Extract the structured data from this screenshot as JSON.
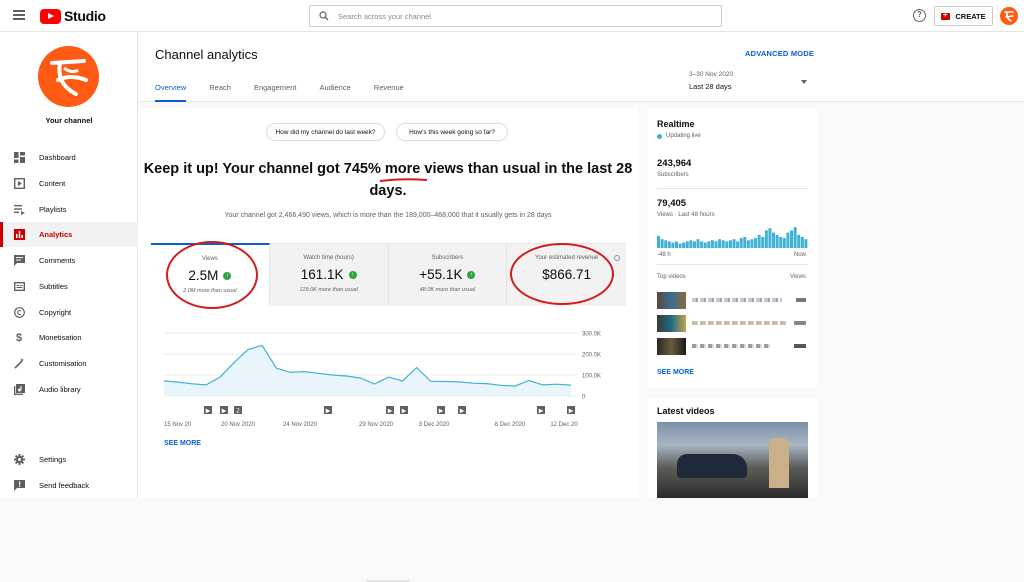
{
  "topbar": {
    "logo_text": "Studio",
    "search_placeholder": "Search across your channel",
    "help_glyph": "?",
    "create_label": "CREATE"
  },
  "sidebar": {
    "channel_label": "Your channel",
    "items": [
      {
        "label": "Dashboard",
        "icon": "dashboard-icon"
      },
      {
        "label": "Content",
        "icon": "content-icon"
      },
      {
        "label": "Playlists",
        "icon": "playlists-icon"
      },
      {
        "label": "Analytics",
        "icon": "analytics-icon"
      },
      {
        "label": "Comments",
        "icon": "comments-icon"
      },
      {
        "label": "Subtitles",
        "icon": "subtitles-icon"
      },
      {
        "label": "Copyright",
        "icon": "copyright-icon"
      },
      {
        "label": "Monetisation",
        "icon": "dollar-icon"
      },
      {
        "label": "Customisation",
        "icon": "magic-wand-icon"
      },
      {
        "label": "Audio library",
        "icon": "audio-library-icon"
      },
      {
        "label": "Settings",
        "icon": "gear-icon"
      },
      {
        "label": "Send feedback",
        "icon": "feedback-icon"
      }
    ]
  },
  "header": {
    "title": "Channel analytics",
    "advanced_mode": "ADVANCED MODE",
    "tabs": [
      "Overview",
      "Reach",
      "Engagement",
      "Audience",
      "Revenue"
    ],
    "date_range": "3–30 Nov 2020",
    "date_label": "Last 28 days"
  },
  "overview": {
    "chip_1": "How did my channel do last week?",
    "chip_2": "How's this week going so far?",
    "headline_pre": "Keep it up! Your channel got ",
    "headline_highlight": "745%",
    "headline_post": " more views than usual in the last 28 days.",
    "subline": "Your channel got 2,466,490 views, which is more than the 189,000–468,000 that it usually gets in 28 days",
    "metrics": [
      {
        "label": "Views",
        "value": "2.5M",
        "note": "2.0M more than usual"
      },
      {
        "label": "Watch time (hours)",
        "value": "161.1K",
        "note": "129.0K more than usual"
      },
      {
        "label": "Subscribers",
        "value": "+55.1K",
        "note": "48.0K more than usual"
      },
      {
        "label": "Your estimated revenue",
        "value": "$866.71",
        "note": ""
      }
    ],
    "see_more": "SEE MORE"
  },
  "chart_data": {
    "type": "area",
    "series": [
      {
        "values": [
          72000,
          66000,
          58000,
          53000,
          90000,
          160000,
          222000,
          241000,
          133000,
          113000,
          116000,
          108000,
          100000,
          95000,
          85000,
          57000,
          90000,
          72000,
          135000,
          70000,
          69000,
          67000,
          61000,
          59000,
          51000,
          47000,
          74000,
          53000,
          56000,
          52000
        ]
      }
    ],
    "x_tick_labels": [
      "15 Nov 20",
      "20 Nov 2020",
      "24 Nov 2020",
      "29 Nov 2020",
      "3 Dec 2020",
      "8 Dec 2020",
      "12 Dec 20"
    ],
    "y_tick_labels": [
      "300.0K",
      "200.0K",
      "100.0K",
      "0"
    ],
    "ylim": [
      0,
      300000
    ],
    "video_markers": [
      "▶",
      "▶",
      "2",
      "▶",
      "▶",
      "▶",
      "▶",
      "▶",
      "▶",
      "▶"
    ],
    "line_color": "#41b1d6",
    "fill_color": "#e8f5fb"
  },
  "realtime": {
    "title": "Realtime",
    "status": "Updating live",
    "subscribers": "243,964",
    "subscribers_label": "Subscribers",
    "views": "79,405",
    "views_label": "Views · Last 48 hours",
    "axis_left": "-48 h",
    "axis_right": "Now",
    "top_videos_label": "Top videos",
    "views_col": "Views",
    "bars": [
      0.55,
      0.4,
      0.35,
      0.3,
      0.25,
      0.3,
      0.2,
      0.25,
      0.3,
      0.35,
      0.3,
      0.4,
      0.3,
      0.25,
      0.3,
      0.35,
      0.3,
      0.4,
      0.35,
      0.3,
      0.35,
      0.4,
      0.3,
      0.45,
      0.5,
      0.35,
      0.4,
      0.45,
      0.6,
      0.5,
      0.8,
      0.9,
      0.7,
      0.6,
      0.5,
      0.45,
      0.7,
      0.8,
      0.95,
      0.6,
      0.5,
      0.4
    ],
    "see_more": "SEE MORE"
  },
  "latest": {
    "title": "Latest videos"
  }
}
